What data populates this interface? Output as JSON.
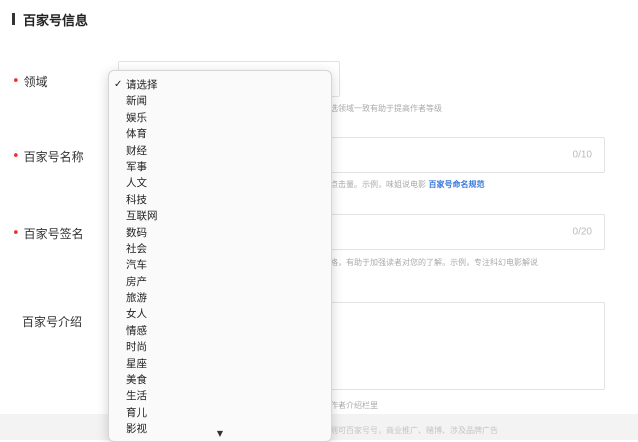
{
  "section": {
    "title": "百家号信息"
  },
  "fields": {
    "domain": {
      "label": "领域",
      "hint": "选领域一致有助于提高作者等级"
    },
    "name": {
      "label": "百家号名称",
      "counter": "0/10",
      "hint_prefix": "点击量。示例，味姐说电影",
      "hint_link": "百家号命名规范"
    },
    "signature": {
      "label": "百家号签名",
      "counter": "0/20",
      "hint": "格，有助于加强读者对您的了解。示例，专注科幻电影解说"
    },
    "intro": {
      "label": "百家号介绍",
      "hint": "作者介绍栏里"
    }
  },
  "dropdown": {
    "selected_index": 0,
    "check_glyph": "✓",
    "options": [
      "请选择",
      "新闻",
      "娱乐",
      "体育",
      "财经",
      "军事",
      "人文",
      "科技",
      "互联网",
      "数码",
      "社会",
      "汽车",
      "房产",
      "旅游",
      "女人",
      "情感",
      "时尚",
      "星座",
      "美食",
      "生活",
      "育儿",
      "影视"
    ],
    "more_arrow": "▼"
  },
  "footer": {
    "hint": "本规则可百家号号，商业推广、赌博、涉及品牌广告"
  }
}
